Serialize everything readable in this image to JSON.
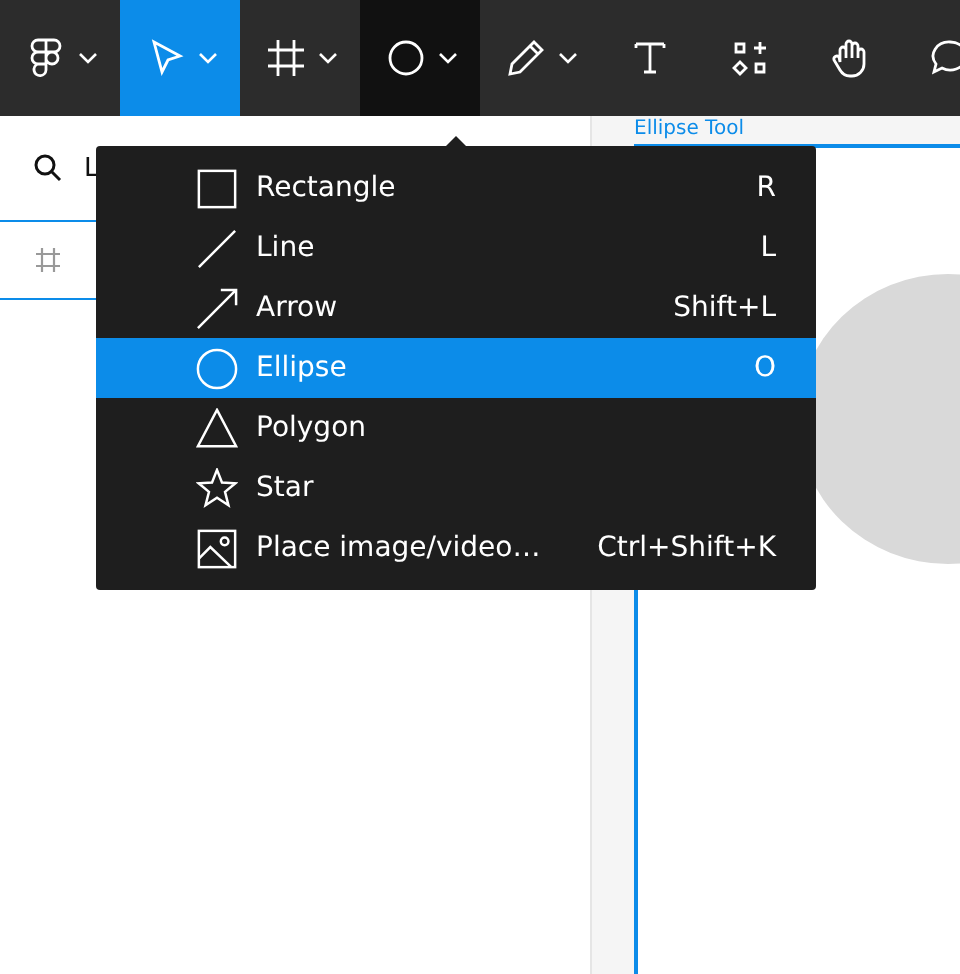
{
  "toolbar": {
    "tools": [
      {
        "dropdown": true,
        "selected": false,
        "menu_open": false
      },
      {
        "dropdown": true,
        "selected": true,
        "menu_open": false
      },
      {
        "dropdown": true,
        "selected": false,
        "menu_open": false
      },
      {
        "dropdown": true,
        "selected": false,
        "menu_open": true
      },
      {
        "dropdown": true,
        "selected": false,
        "menu_open": false
      },
      {
        "dropdown": false,
        "selected": false,
        "menu_open": false
      },
      {
        "dropdown": false,
        "selected": false,
        "menu_open": false
      },
      {
        "dropdown": false,
        "selected": false,
        "menu_open": false
      },
      {
        "dropdown": false,
        "selected": false,
        "menu_open": false
      }
    ]
  },
  "layers_panel": {
    "search": {
      "value": "L"
    },
    "layers": [
      {
        "selected": true
      }
    ]
  },
  "canvas": {
    "frame": {
      "label": "Ellipse Tool"
    }
  },
  "shape_menu": {
    "items": [
      {
        "label": "Rectangle",
        "shortcut": "R",
        "selected": false
      },
      {
        "label": "Line",
        "shortcut": "L",
        "selected": false
      },
      {
        "label": "Arrow",
        "shortcut": "Shift+L",
        "selected": false
      },
      {
        "label": "Ellipse",
        "shortcut": "O",
        "selected": true
      },
      {
        "label": "Polygon",
        "selected": false
      },
      {
        "label": "Star",
        "selected": false
      },
      {
        "label": "Place image/video…",
        "shortcut": "Ctrl+Shift+K",
        "selected": false
      }
    ]
  }
}
